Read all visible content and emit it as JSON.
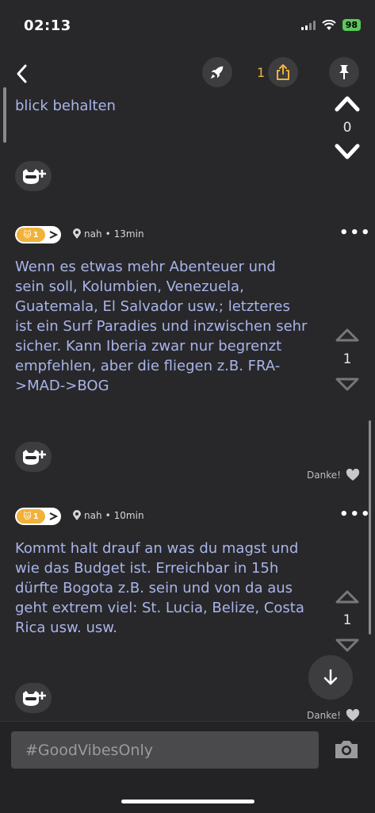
{
  "status": {
    "time": "02:13",
    "battery": "98"
  },
  "header": {
    "share_count": "1"
  },
  "top_post": {
    "text_tail": "blick behalten",
    "votes": "0"
  },
  "posts": [
    {
      "badge_level": "1",
      "location": "nah",
      "time": "13min",
      "text": "Wenn es etwas mehr Abenteuer und sein soll, Kolumbien, Venezuela, Guatemala, El Salvador usw.; letzteres ist ein Surf Paradies und inzwischen sehr sicher. Kann Iberia zwar nur begrenzt empfehlen, aber die fliegen z.B. FRA->MAD->BOG",
      "votes": "1",
      "thanks_label": "Danke!"
    },
    {
      "badge_level": "1",
      "location": "nah",
      "time": "10min",
      "text": "Kommt halt drauf an was du magst und wie das Budget ist. Erreichbar in 15h dürfte Bogota z.B. sein und von da aus geht extrem viel: St. Lucia, Belize, Costa Rica usw. usw.",
      "votes": "1",
      "thanks_label": "Danke!"
    }
  ],
  "composer": {
    "placeholder": "#GoodVibesOnly"
  },
  "icons": {
    "back": "chevron-left-icon",
    "rocket": "rocket-icon",
    "share": "share-icon",
    "pin": "pin-icon",
    "upvote": "chevron-up-icon",
    "downvote": "chevron-down-icon",
    "avatar_add": "cat-avatar-plus-icon",
    "location": "location-pin-icon",
    "heart": "heart-icon",
    "more": "more-dots-icon",
    "scroll_down": "arrow-down-icon",
    "camera": "camera-icon"
  },
  "colors": {
    "background": "#28282a",
    "post_text": "#a9b4ea",
    "accent": "#f0b23a",
    "battery": "#5ac85a"
  }
}
